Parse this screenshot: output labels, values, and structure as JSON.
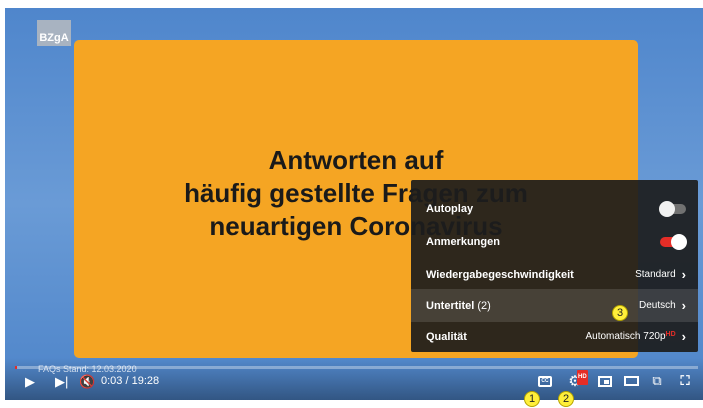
{
  "video": {
    "logo": "BZgA",
    "slide_lines": [
      "Antworten auf",
      "häufig gestellte Fragen zum",
      "neuartigen Coronavirus"
    ]
  },
  "settings_menu": {
    "items": [
      {
        "label": "Autoplay",
        "type": "toggle",
        "state": "off"
      },
      {
        "label": "Anmerkungen",
        "type": "toggle",
        "state": "on"
      },
      {
        "label": "Wiedergabegeschwindigkeit",
        "value": "Standard"
      },
      {
        "label": "Untertitel",
        "count": "(2)",
        "value": "Deutsch"
      },
      {
        "label": "Qualität",
        "value": "Automatisch 720p",
        "badge": "HD"
      }
    ]
  },
  "controls": {
    "chapter_text": "FAQs Stand: 12.03.2020",
    "time": "0:03 / 19:28",
    "progress": 0.003,
    "settings_badge": "HD",
    "subtitles_icon_text": "CC"
  },
  "markers": [
    "1",
    "2",
    "3"
  ],
  "colors": {
    "accent": "#e52d27",
    "slide": "#f5a523",
    "background": "#5b8fcf",
    "marker": "#ffef3a"
  }
}
